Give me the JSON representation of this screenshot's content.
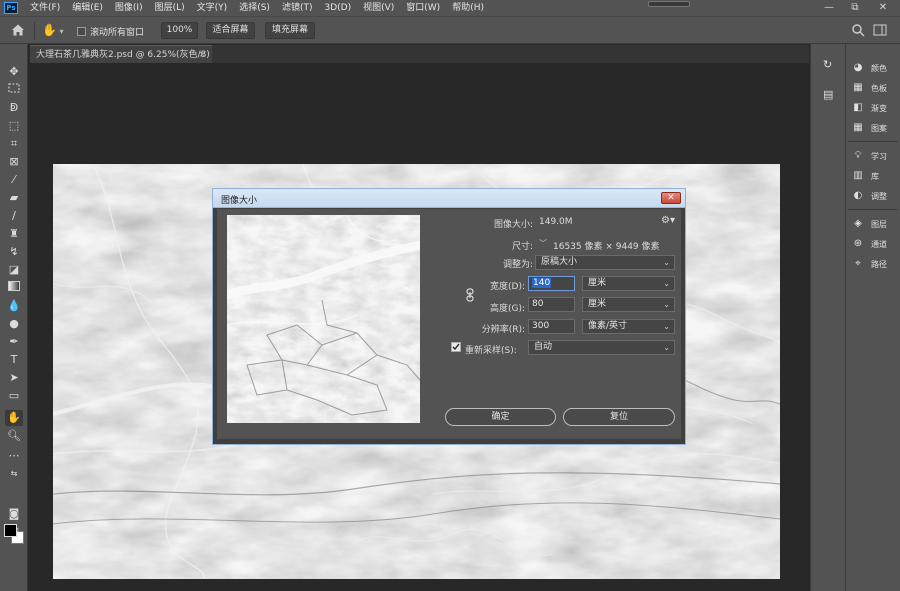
{
  "app": {
    "logo": "Ps"
  },
  "menu": [
    "文件(F)",
    "编辑(E)",
    "图像(I)",
    "图层(L)",
    "文字(Y)",
    "选择(S)",
    "滤镜(T)",
    "3D(D)",
    "视图(V)",
    "窗口(W)",
    "帮助(H)"
  ],
  "window_controls": {
    "minimize": "—",
    "restore": "⧉",
    "close": "✕"
  },
  "options": {
    "scroll_all_label": "滚动所有窗口",
    "zoom_button": "100%",
    "fit_screen_button": "适合屏幕",
    "fill_screen_button": "填充屏幕"
  },
  "document_tab": {
    "title": "大理石茶几雅典灰2.psd @ 6.25%(灰色/8)",
    "close": "×"
  },
  "right_panels": {
    "group1": [
      {
        "icon": "palette-icon",
        "label": "颜色"
      },
      {
        "icon": "swatches-icon",
        "label": "色板"
      },
      {
        "icon": "gradient-icon",
        "label": "渐变"
      },
      {
        "icon": "patterns-icon",
        "label": "图案"
      }
    ],
    "group2": [
      {
        "icon": "bulb-icon",
        "label": "学习"
      },
      {
        "icon": "library-icon",
        "label": "库"
      },
      {
        "icon": "adjust-icon",
        "label": "调整"
      }
    ],
    "group3": [
      {
        "icon": "layers-icon",
        "label": "图层"
      },
      {
        "icon": "channels-icon",
        "label": "通道"
      },
      {
        "icon": "paths-icon",
        "label": "路径"
      }
    ]
  },
  "dialog": {
    "title": "图像大小",
    "close": "✕",
    "image_size_label": "图像大小:",
    "image_size_value": "149.0M",
    "dimensions_label": "尺寸:",
    "dimensions_value": "16535 像素  ×  9449 像素",
    "fit_to_label": "调整为:",
    "fit_to_value": "原稿大小",
    "width_label": "宽度(D):",
    "width_value": "140",
    "width_unit": "厘米",
    "height_label": "高度(G):",
    "height_value": "80",
    "height_unit": "厘米",
    "resolution_label": "分辨率(R):",
    "resolution_value": "300",
    "resolution_unit": "像素/英寸",
    "resample_label": "重新采样(S):",
    "resample_value": "自动",
    "resample_checked": true,
    "ok_button": "确定",
    "reset_button": "复位"
  }
}
